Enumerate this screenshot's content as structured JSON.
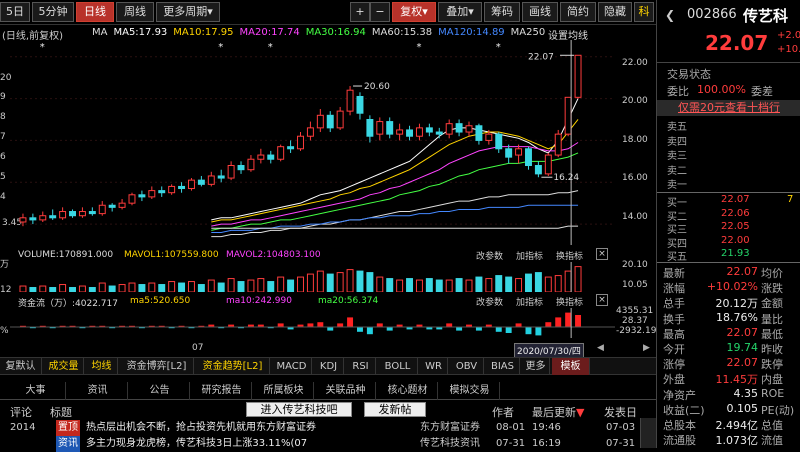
{
  "toolbar": {
    "period_labels": [
      "5日",
      "5分钟",
      "日线",
      "周线",
      "更多周期"
    ],
    "active_period": "日线",
    "tool_labels": [
      "+",
      "−",
      "复权",
      "叠加",
      "筹码",
      "画线",
      "简约",
      "隐藏"
    ],
    "dropdown_glyph": "▾",
    "tool_right_label": "隐藏",
    "menu_right_glyph": "科"
  },
  "chart_header": {
    "prefix": "(日线,前复权)",
    "ma_labels": [
      {
        "text": "MA",
        "color": "#dddddd"
      },
      {
        "text": "MA5:17.93",
        "color": "#ffffff"
      },
      {
        "text": "MA10:17.95",
        "color": "#ffd400"
      },
      {
        "text": "MA20:17.74",
        "color": "#ff44ff"
      },
      {
        "text": "MA30:16.94",
        "color": "#44ff44"
      },
      {
        "text": "MA60:15.38",
        "color": "#dddddd"
      },
      {
        "text": "MA120:14.89",
        "color": "#4488ff"
      },
      {
        "text": "MA250",
        "color": "#dddddd"
      }
    ],
    "settings_label": "设置均线",
    "left_axis_labels": [
      "20",
      "9",
      "8",
      "7",
      "6",
      "5",
      "4",
      "3.45",
      "万",
      "%",
      "12"
    ],
    "price_ticks": [
      "22.00",
      "20.00",
      "18.00",
      "16.00",
      "14.00"
    ],
    "annotations": {
      "high": "20.60",
      "recent_high": "22.07",
      "low": "16.24"
    }
  },
  "chart_data": {
    "type": "candlestick",
    "ylim": [
      13.0,
      22.8
    ],
    "candles": [
      {
        "o": 14.1,
        "c": 14.3,
        "h": 14.5,
        "l": 13.9,
        "up": true
      },
      {
        "o": 14.3,
        "c": 14.2,
        "h": 14.5,
        "l": 14.0,
        "up": false
      },
      {
        "o": 14.2,
        "c": 14.4,
        "h": 14.6,
        "l": 14.1,
        "up": true
      },
      {
        "o": 14.4,
        "c": 14.3,
        "h": 14.7,
        "l": 14.2,
        "up": false
      },
      {
        "o": 14.3,
        "c": 14.6,
        "h": 14.8,
        "l": 14.2,
        "up": true
      },
      {
        "o": 14.6,
        "c": 14.4,
        "h": 14.7,
        "l": 14.3,
        "up": false
      },
      {
        "o": 14.4,
        "c": 14.6,
        "h": 14.8,
        "l": 14.3,
        "up": true
      },
      {
        "o": 14.6,
        "c": 14.5,
        "h": 14.8,
        "l": 14.4,
        "up": false
      },
      {
        "o": 14.5,
        "c": 14.9,
        "h": 15.1,
        "l": 14.4,
        "up": true
      },
      {
        "o": 14.9,
        "c": 14.8,
        "h": 15.0,
        "l": 14.6,
        "up": false
      },
      {
        "o": 14.8,
        "c": 15.0,
        "h": 15.2,
        "l": 14.7,
        "up": true
      },
      {
        "o": 15.0,
        "c": 15.4,
        "h": 15.5,
        "l": 14.9,
        "up": true
      },
      {
        "o": 15.4,
        "c": 15.3,
        "h": 15.6,
        "l": 15.1,
        "up": false
      },
      {
        "o": 15.3,
        "c": 15.6,
        "h": 15.8,
        "l": 15.2,
        "up": true
      },
      {
        "o": 15.6,
        "c": 15.5,
        "h": 15.8,
        "l": 15.3,
        "up": false
      },
      {
        "o": 15.5,
        "c": 15.8,
        "h": 15.9,
        "l": 15.4,
        "up": true
      },
      {
        "o": 15.8,
        "c": 15.7,
        "h": 16.0,
        "l": 15.5,
        "up": false
      },
      {
        "o": 15.7,
        "c": 16.1,
        "h": 16.2,
        "l": 15.6,
        "up": true
      },
      {
        "o": 16.1,
        "c": 15.9,
        "h": 16.3,
        "l": 15.8,
        "up": false
      },
      {
        "o": 15.9,
        "c": 16.3,
        "h": 16.5,
        "l": 15.8,
        "up": true
      },
      {
        "o": 16.3,
        "c": 16.2,
        "h": 16.6,
        "l": 16.0,
        "up": false
      },
      {
        "o": 16.2,
        "c": 16.8,
        "h": 17.0,
        "l": 16.1,
        "up": true
      },
      {
        "o": 16.8,
        "c": 16.6,
        "h": 17.0,
        "l": 16.4,
        "up": false
      },
      {
        "o": 16.6,
        "c": 17.1,
        "h": 17.3,
        "l": 16.5,
        "up": true
      },
      {
        "o": 17.1,
        "c": 17.3,
        "h": 17.6,
        "l": 16.9,
        "up": true
      },
      {
        "o": 17.3,
        "c": 17.1,
        "h": 17.5,
        "l": 16.9,
        "up": false
      },
      {
        "o": 17.1,
        "c": 17.7,
        "h": 17.8,
        "l": 17.0,
        "up": true
      },
      {
        "o": 17.7,
        "c": 17.6,
        "h": 18.0,
        "l": 17.4,
        "up": false
      },
      {
        "o": 17.6,
        "c": 18.2,
        "h": 18.4,
        "l": 17.5,
        "up": true
      },
      {
        "o": 18.2,
        "c": 18.6,
        "h": 18.9,
        "l": 18.0,
        "up": true
      },
      {
        "o": 18.6,
        "c": 19.2,
        "h": 19.5,
        "l": 18.4,
        "up": true
      },
      {
        "o": 19.2,
        "c": 18.6,
        "h": 19.4,
        "l": 18.4,
        "up": false
      },
      {
        "o": 18.6,
        "c": 19.4,
        "h": 19.6,
        "l": 18.5,
        "up": true
      },
      {
        "o": 19.4,
        "c": 20.4,
        "h": 20.6,
        "l": 19.2,
        "up": true
      },
      {
        "o": 20.1,
        "c": 19.3,
        "h": 20.3,
        "l": 19.0,
        "up": false
      },
      {
        "o": 19.0,
        "c": 18.2,
        "h": 19.2,
        "l": 17.9,
        "up": false
      },
      {
        "o": 18.3,
        "c": 18.9,
        "h": 19.1,
        "l": 18.0,
        "up": true
      },
      {
        "o": 18.9,
        "c": 18.3,
        "h": 19.1,
        "l": 18.1,
        "up": false
      },
      {
        "o": 18.3,
        "c": 18.5,
        "h": 18.8,
        "l": 18.0,
        "up": true
      },
      {
        "o": 18.5,
        "c": 18.2,
        "h": 18.7,
        "l": 18.0,
        "up": false
      },
      {
        "o": 18.2,
        "c": 18.6,
        "h": 18.8,
        "l": 18.0,
        "up": true
      },
      {
        "o": 18.6,
        "c": 18.4,
        "h": 18.8,
        "l": 18.2,
        "up": false
      },
      {
        "o": 18.4,
        "c": 18.3,
        "h": 18.6,
        "l": 18.1,
        "up": false
      },
      {
        "o": 18.3,
        "c": 18.8,
        "h": 19.0,
        "l": 18.1,
        "up": true
      },
      {
        "o": 18.8,
        "c": 18.4,
        "h": 19.0,
        "l": 18.2,
        "up": false
      },
      {
        "o": 18.4,
        "c": 18.7,
        "h": 18.9,
        "l": 18.2,
        "up": true
      },
      {
        "o": 18.7,
        "c": 18.0,
        "h": 18.8,
        "l": 17.8,
        "up": false
      },
      {
        "o": 18.0,
        "c": 18.3,
        "h": 18.5,
        "l": 17.8,
        "up": true
      },
      {
        "o": 18.3,
        "c": 17.6,
        "h": 18.4,
        "l": 17.4,
        "up": false
      },
      {
        "o": 17.6,
        "c": 17.2,
        "h": 17.8,
        "l": 16.9,
        "up": false
      },
      {
        "o": 17.3,
        "c": 17.6,
        "h": 17.8,
        "l": 16.9,
        "up": true
      },
      {
        "o": 17.6,
        "c": 16.8,
        "h": 17.7,
        "l": 16.6,
        "up": false
      },
      {
        "o": 16.8,
        "c": 16.4,
        "h": 17.0,
        "l": 16.24,
        "up": false
      },
      {
        "o": 16.4,
        "c": 17.3,
        "h": 17.4,
        "l": 16.3,
        "up": true
      },
      {
        "o": 17.3,
        "c": 18.3,
        "h": 18.5,
        "l": 17.2,
        "up": true
      },
      {
        "o": 18.3,
        "c": 20.06,
        "h": 20.06,
        "l": 18.2,
        "up": true
      },
      {
        "o": 20.06,
        "c": 22.07,
        "h": 22.07,
        "l": 20.0,
        "up": true
      }
    ],
    "ma_lines": [
      {
        "name": "MA5",
        "color": "#ffffff",
        "values": [
          14.2,
          14.3,
          14.3,
          14.4,
          14.5,
          14.6,
          14.7,
          14.8,
          14.9,
          15.0,
          15.2,
          15.4,
          15.5,
          15.6,
          15.8,
          16.0,
          16.2,
          16.4,
          16.6,
          16.8,
          17.0,
          17.4,
          17.8,
          18.2,
          18.5,
          18.6,
          18.6,
          18.5,
          18.4,
          18.3,
          18.2,
          18.1,
          17.9,
          17.6,
          17.4,
          18.0,
          19.0,
          20.0
        ]
      },
      {
        "name": "MA10",
        "color": "#ffd400",
        "values": [
          14.1,
          14.2,
          14.2,
          14.3,
          14.4,
          14.5,
          14.6,
          14.7,
          14.8,
          14.9,
          15.0,
          15.1,
          15.2,
          15.4,
          15.5,
          15.7,
          15.8,
          16.0,
          16.2,
          16.4,
          16.6,
          16.9,
          17.2,
          17.5,
          17.8,
          18.0,
          18.2,
          18.3,
          18.4,
          18.4,
          18.3,
          18.2,
          18.0,
          17.8,
          17.6,
          17.8,
          18.4,
          19.0
        ]
      },
      {
        "name": "MA20",
        "color": "#ff44ff",
        "values": [
          13.9,
          14.0,
          14.0,
          14.1,
          14.2,
          14.2,
          14.3,
          14.4,
          14.5,
          14.6,
          14.7,
          14.8,
          14.9,
          15.0,
          15.1,
          15.2,
          15.4,
          15.5,
          15.7,
          15.8,
          16.0,
          16.2,
          16.4,
          16.6,
          16.9,
          17.1,
          17.3,
          17.5,
          17.6,
          17.7,
          17.7,
          17.7,
          17.7,
          17.6,
          17.5,
          17.5,
          17.6,
          17.9
        ]
      },
      {
        "name": "MA30",
        "color": "#44ff44",
        "values": [
          13.7,
          13.8,
          13.8,
          13.9,
          14.0,
          14.0,
          14.1,
          14.2,
          14.2,
          14.3,
          14.4,
          14.5,
          14.6,
          14.7,
          14.8,
          14.9,
          15.0,
          15.1,
          15.2,
          15.4,
          15.5,
          15.6,
          15.8,
          15.9,
          16.1,
          16.3,
          16.4,
          16.6,
          16.7,
          16.8,
          16.9,
          16.9,
          17.0,
          17.0,
          17.0,
          17.1,
          17.2,
          17.4
        ]
      },
      {
        "name": "MA60",
        "color": "#dddddd",
        "values": [
          13.4,
          13.4,
          13.5,
          13.5,
          13.6,
          13.6,
          13.7,
          13.7,
          13.8,
          13.8,
          13.9,
          14.0,
          14.0,
          14.1,
          14.2,
          14.2,
          14.3,
          14.4,
          14.5,
          14.6,
          14.6,
          14.7,
          14.8,
          14.9,
          15.0,
          15.1,
          15.1,
          15.2,
          15.3,
          15.3,
          15.4,
          15.4,
          15.4,
          15.4,
          15.4,
          15.5,
          15.5,
          15.6
        ]
      },
      {
        "name": "MA120",
        "color": "#4488ff",
        "values": [
          13.6,
          13.6,
          13.7,
          13.7,
          13.7,
          13.8,
          13.8,
          13.9,
          13.9,
          13.9,
          14.0,
          14.0,
          14.1,
          14.1,
          14.2,
          14.2,
          14.3,
          14.3,
          14.4,
          14.4,
          14.4,
          14.5,
          14.5,
          14.6,
          14.6,
          14.7,
          14.7,
          14.7,
          14.8,
          14.8,
          14.8,
          14.8,
          14.9,
          14.9,
          14.9,
          14.9,
          14.9,
          14.9
        ]
      },
      {
        "name": "MA250",
        "color": "#dddddd",
        "values": [
          13.8,
          13.8,
          13.8,
          13.8,
          13.8,
          13.8,
          13.8,
          13.8,
          13.8,
          13.8,
          13.8,
          13.8,
          13.8,
          13.8,
          13.8,
          13.8,
          13.8,
          13.8,
          13.8,
          13.8,
          13.8,
          13.8,
          13.8,
          13.8,
          13.8,
          13.8,
          13.8,
          13.8,
          13.8,
          13.8,
          13.8,
          13.8,
          13.8,
          13.8,
          13.8,
          13.8,
          13.9,
          13.9
        ]
      }
    ],
    "volume": [
      4,
      3,
      4,
      3,
      5,
      3,
      4,
      3,
      6,
      4,
      5,
      6,
      5,
      6,
      5,
      7,
      6,
      7,
      5,
      8,
      6,
      9,
      7,
      8,
      9,
      7,
      10,
      8,
      10,
      12,
      14,
      12,
      13,
      15,
      14,
      13,
      10,
      9,
      8,
      9,
      8,
      9,
      8,
      8,
      9,
      8,
      10,
      9,
      11,
      10,
      9,
      12,
      13,
      10,
      11,
      14,
      17
    ],
    "volume_max": 20.1,
    "fund_flow": [
      1,
      -1,
      1,
      -1,
      1,
      1,
      -1,
      1,
      1,
      -1,
      1,
      1,
      -1,
      1,
      1,
      -1,
      1,
      -1,
      1,
      2,
      -1,
      2,
      -1,
      2,
      2,
      -1,
      3,
      -2,
      2,
      3,
      4,
      -3,
      3,
      8,
      -4,
      -6,
      3,
      -3,
      2,
      -2,
      2,
      -2,
      -2,
      3,
      -3,
      2,
      -3,
      2,
      -4,
      -5,
      3,
      -6,
      -7,
      4,
      8,
      12,
      10
    ]
  },
  "volume_panel": {
    "header": "VOLUME:170891.000",
    "mavol1": "MAVOL1:107559.800",
    "mavol2": "MAVOL2:104803.100",
    "change_param": "改参数",
    "add_indicator": "加指标",
    "swap_indicator": "换指标",
    "scale_top": "20.10",
    "scale_mid": "10.05",
    "unit": "万"
  },
  "flow_panel": {
    "title": "资金流（万）:4022.717",
    "ma5": "ma5:520.650",
    "ma10": "ma10:242.990",
    "ma20": "ma20:56.374",
    "change_param": "改参数",
    "add_indicator": "加指标",
    "swap_indicator": "换指标",
    "scale_top": "4355.31",
    "scale_mid": "28.37",
    "scale_bottom": "-2932.19"
  },
  "date_tip": "2020/07/30/四",
  "axis_month": "07",
  "indicator_tabs": [
    "复默认",
    "成交量",
    "均线",
    "资金博弈[L2]",
    "资金趋势[L2]",
    "MACD",
    "KDJ",
    "RSI",
    "BOLL",
    "WR",
    "OBV",
    "BIAS",
    "更多",
    "模板"
  ],
  "news_tabs": [
    "大事",
    "资讯",
    "公告",
    "研究报告",
    "所属板块",
    "关联品种",
    "核心题材",
    "模拟交易"
  ],
  "news_header": {
    "col1": "评论",
    "col2": "标题",
    "enter_button": "进入传艺科技吧",
    "post_button": "发新帖",
    "author": "作者",
    "latest": "最后更新",
    "time": "发表日"
  },
  "news_rows": [
    {
      "year": "2014",
      "tag": "置顶",
      "title": "热点层出机会不断，抢占投资先机就用东方财富证券",
      "author": "东方财富证券",
      "date1": "08-01",
      "time": "19:46",
      "date2": "07-03"
    },
    {
      "year": "",
      "tag": "资讯",
      "title": "多主力现身龙虎榜，传艺科技3日上涨33.11%(07",
      "author": "传艺科技资讯",
      "date1": "07-31",
      "time": "16:19",
      "date2": "07-31"
    }
  ],
  "quote": {
    "code": "002866",
    "name": "传艺科",
    "price": "22.07",
    "change": "+2.0",
    "change_pct": "+10.",
    "status_title": "交易状态",
    "weibi_label": "委比",
    "weibi_value": "100.00%",
    "weicha_label": "委差",
    "banner": "仅需20元查看十档行",
    "sell_labels": [
      "卖五",
      "卖四",
      "卖三",
      "卖二",
      "卖一"
    ],
    "buy_levels": [
      {
        "label": "买一",
        "price": "22.07",
        "vol": "7"
      },
      {
        "label": "买二",
        "price": "22.06",
        "vol": ""
      },
      {
        "label": "买三",
        "price": "22.05",
        "vol": ""
      },
      {
        "label": "买四",
        "price": "22.00",
        "vol": ""
      },
      {
        "label": "买五",
        "price": "21.93",
        "vol": ""
      }
    ],
    "stats": [
      {
        "l": "最新",
        "v": "22.07",
        "vc": "red",
        "r": "均价"
      },
      {
        "l": "涨幅",
        "v": "+10.02%",
        "vc": "red",
        "r": "涨跌"
      },
      {
        "l": "总手",
        "v": "20.12万",
        "vc": "white",
        "r": "金额"
      },
      {
        "l": "换手",
        "v": "18.76%",
        "vc": "white",
        "r": "量比"
      },
      {
        "l": "最高",
        "v": "22.07",
        "vc": "red",
        "r": "最低"
      },
      {
        "l": "今开",
        "v": "19.74",
        "vc": "green",
        "r": "昨收"
      },
      {
        "l": "涨停",
        "v": "22.07",
        "vc": "red",
        "r": "跌停"
      },
      {
        "l": "外盘",
        "v": "11.45万",
        "vc": "red",
        "r": "内盘"
      },
      {
        "l": "净资产",
        "v": "4.35",
        "vc": "white",
        "r": "ROE"
      },
      {
        "l": "收益(二)",
        "v": "0.105",
        "vc": "white",
        "r": "PE(动)"
      },
      {
        "l": "总股本",
        "v": "2.494亿",
        "vc": "white",
        "r": "总值"
      },
      {
        "l": "流通股",
        "v": "1.073亿",
        "vc": "white",
        "r": "流值"
      }
    ]
  }
}
